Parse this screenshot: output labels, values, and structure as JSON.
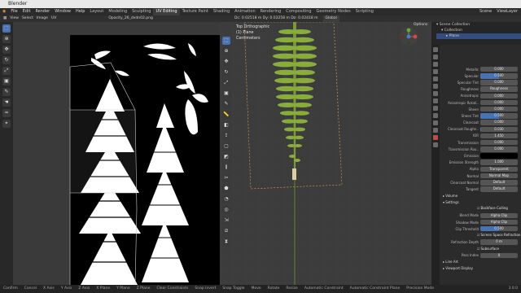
{
  "window": {
    "title": "Blender"
  },
  "menu": {
    "items": [
      "File",
      "Edit",
      "Render",
      "Window",
      "Help"
    ],
    "workspaces": [
      "Layout",
      "Modeling",
      "Sculpting",
      "UV Editing",
      "Texture Paint",
      "Shading",
      "Animation",
      "Rendering",
      "Compositing",
      "Geometry Nodes",
      "Scripting"
    ],
    "active_workspace": "UV Editing",
    "scene": "Scene",
    "view_layer": "ViewLayer"
  },
  "uv_editor": {
    "menu": [
      "View",
      "Select",
      "Image",
      "UV"
    ],
    "image_name": "Opacity_26_dvdn02.png"
  },
  "viewport": {
    "stats": "Dc: 0.02518 m  Dy: 0.03258 m  Dz: 0.02418 m",
    "orientation": "Global",
    "view_name": "Top Orthographic",
    "object": "(1) Plane",
    "units": "Centimeters",
    "options_label": "Options"
  },
  "outliner": {
    "title": "Scene Collection",
    "collection": "Collection",
    "object": "Plane"
  },
  "properties": {
    "rows": [
      {
        "label": "Metallic",
        "value": "0.000",
        "fill": 0
      },
      {
        "label": "Specular",
        "value": "0.500",
        "fill": 0.5
      },
      {
        "label": "Specular Tint",
        "value": "0.000",
        "fill": 0
      },
      {
        "label": "Roughness",
        "value": "Roughness",
        "fill": 0
      },
      {
        "label": "Anisotropic",
        "value": "0.000",
        "fill": 0
      },
      {
        "label": "Anisotropic Rotati..",
        "value": "0.000",
        "fill": 0
      },
      {
        "label": "Sheen",
        "value": "0.000",
        "fill": 0
      },
      {
        "label": "Sheen Tint",
        "value": "0.500",
        "fill": 0.5
      },
      {
        "label": "Clearcoat",
        "value": "0.000",
        "fill": 0
      },
      {
        "label": "Clearcoat Roughn..",
        "value": "0.030",
        "fill": 0.03
      },
      {
        "label": "IOR",
        "value": "1.450",
        "fill": 0
      },
      {
        "label": "Transmission",
        "value": "0.000",
        "fill": 0
      },
      {
        "label": "Transmission Rou..",
        "value": "0.000",
        "fill": 0
      },
      {
        "label": "Emission",
        "value": "",
        "fill": 0
      },
      {
        "label": "Emission Strength",
        "value": "1.000",
        "fill": 0
      },
      {
        "label": "Alpha",
        "value": "Transparent",
        "fill": 0
      },
      {
        "label": "Normal",
        "value": "Normal Map",
        "fill": 0
      },
      {
        "label": "Clearcoat Normal",
        "value": "Default",
        "fill": 0
      },
      {
        "label": "Tangent",
        "value": "Default",
        "fill": 0
      }
    ],
    "volume": "Volume",
    "settings": "Settings",
    "settings_rows": [
      {
        "label": "",
        "value": "Backface Culling"
      },
      {
        "label": "Blend Mode",
        "value": "Alpha Clip"
      },
      {
        "label": "Shadow Mode",
        "value": "Alpha Clip"
      },
      {
        "label": "Clip Threshold",
        "value": "0.500"
      },
      {
        "label": "",
        "value": "Screen Space Refraction"
      },
      {
        "label": "Refraction Depth",
        "value": "0 m"
      },
      {
        "label": "",
        "value": "Subsurface Translucency"
      },
      {
        "label": "Pass Index",
        "value": "0"
      }
    ],
    "line_art": "Line Art",
    "viewport_display": "Viewport Display"
  },
  "status": {
    "items": [
      "Confirm",
      "Cancel",
      "X Axis",
      "Y Axis",
      "Z Axis",
      "X Plane",
      "Y Plane",
      "Z Plane",
      "Clear Constraints",
      "Snap Invert",
      "Snap Toggle",
      "Move",
      "Rotate",
      "Resize",
      "Automatic Constraint",
      "Automatic Constraint Plane",
      "Precision Mode"
    ],
    "version": "3.0.0"
  }
}
